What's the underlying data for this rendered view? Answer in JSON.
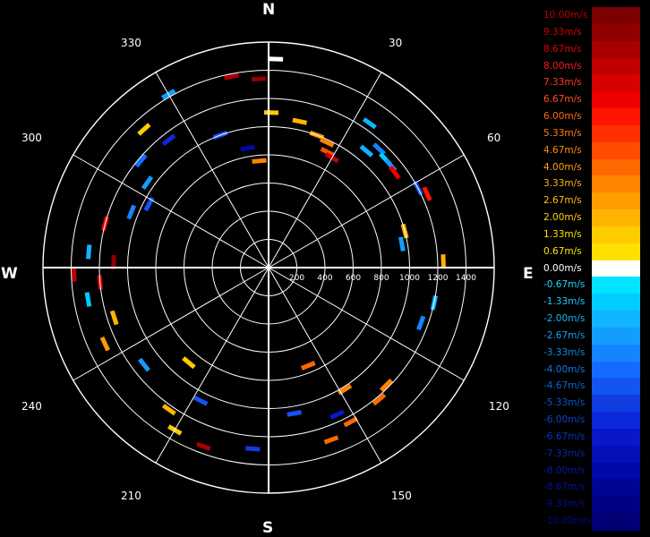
{
  "chart_data": {
    "type": "polar-radar",
    "cardinals": {
      "north": "N",
      "east": "E",
      "south": "S",
      "west": "W"
    },
    "azimuth_labels": [
      "30",
      "60",
      "120",
      "150",
      "210",
      "240",
      "300",
      "330"
    ],
    "azimuth_label_angles": [
      30,
      60,
      120,
      150,
      210,
      240,
      300,
      330
    ],
    "range_rings": [
      200,
      400,
      600,
      800,
      1000,
      1200,
      1400
    ],
    "range_tick_labels": [
      "200",
      "400",
      "600",
      "800",
      "1000",
      "1200",
      "1400"
    ],
    "max_range": 1600,
    "grid": true,
    "radial_lines_every_deg": 30,
    "legend": {
      "placement": "right",
      "labels": [
        "10.00m/s",
        "9.33m/s",
        "8.67m/s",
        "8.00m/s",
        "7.33m/s",
        "6.67m/s",
        "6.00m/s",
        "5.33m/s",
        "4.67m/s",
        "4.00m/s",
        "3.33m/s",
        "2.67m/s",
        "2.00m/s",
        "1.33m/s",
        "0.67m/s",
        "0.00m/s",
        "-0.67m/s",
        "-1.33m/s",
        "-2.00m/s",
        "-2.67m/s",
        "-3.33m/s",
        "-4.00m/s",
        "-4.67m/s",
        "-5.33m/s",
        "-6.00m/s",
        "-6.67m/s",
        "-7.33m/s",
        "-8.00m/s",
        "-8.67m/s",
        "-9.33m/s",
        "-10.00m/s"
      ],
      "label_colors": [
        "#c00000",
        "#d40000",
        "#e00000",
        "#ff1a1a",
        "#ff3a1a",
        "#ff5020",
        "#ff6a10",
        "#ff7a10",
        "#ff8c10",
        "#ffa010",
        "#ffb010",
        "#ffc010",
        "#ffd010",
        "#ffe000",
        "#ffe800",
        "#ffffff",
        "#20d8ff",
        "#1ac8ff",
        "#14b4f5",
        "#109ff0",
        "#0f8ae8",
        "#0d78e0",
        "#0b66d8",
        "#0a55d0",
        "#0a44c8",
        "#0933c0",
        "#0826b0",
        "#071aa0",
        "#06129a",
        "#050c90",
        "#040888"
      ],
      "swatch_colors": [
        "#7d0000",
        "#900000",
        "#a80000",
        "#c00000",
        "#d80000",
        "#ee0000",
        "#ff1400",
        "#ff3000",
        "#ff4c00",
        "#ff6800",
        "#ff8400",
        "#ff9c00",
        "#ffb400",
        "#ffcc00",
        "#ffe000",
        "#ffffff",
        "#00e4ff",
        "#00ccff",
        "#10b4ff",
        "#149cff",
        "#1484ff",
        "#146cff",
        "#1454f0",
        "#103ce0",
        "#0c28d8",
        "#0818c8",
        "#0410b8",
        "#0008a8",
        "#000494",
        "#000084",
        "#000074"
      ]
    },
    "velocity_colormap": {
      "positive": [
        "#ffe000",
        "#ffcc00",
        "#ffb400",
        "#ff9c00",
        "#ff8400",
        "#ff6800",
        "#ff4c00",
        "#ff3000",
        "#ff1400",
        "#ee0000",
        "#d80000",
        "#c00000",
        "#a80000",
        "#900000",
        "#7d0000"
      ],
      "negative": [
        "#00e4ff",
        "#00ccff",
        "#10b4ff",
        "#149cff",
        "#1484ff",
        "#146cff",
        "#1454f0",
        "#103ce0",
        "#0c28d8",
        "#0818c8",
        "#0410b8",
        "#0008a8",
        "#000494",
        "#000084",
        "#000074"
      ],
      "zero": "#ffffff"
    },
    "velocity_gates": [
      {
        "az": 2,
        "range": 1480,
        "v": 0.0
      },
      {
        "az": -3,
        "range": 1340,
        "v": 9.3
      },
      {
        "az": -11,
        "range": 1380,
        "v": 8.7
      },
      {
        "az": 1,
        "range": 1100,
        "v": 1.3
      },
      {
        "az": 12,
        "range": 1060,
        "v": 2.0
      },
      {
        "az": 20,
        "range": 1000,
        "v": 2.7
      },
      {
        "az": 25,
        "range": 980,
        "v": 3.3
      },
      {
        "az": 27,
        "range": 920,
        "v": 4.7
      },
      {
        "az": 30,
        "range": 900,
        "v": 8.0
      },
      {
        "az": 35,
        "range": 1250,
        "v": -2.0
      },
      {
        "az": 40,
        "range": 1080,
        "v": -2.0
      },
      {
        "az": 43,
        "range": 1150,
        "v": -3.3
      },
      {
        "az": 47,
        "range": 1130,
        "v": -1.3
      },
      {
        "az": 50,
        "range": 1130,
        "v": -2.7
      },
      {
        "az": 53,
        "range": 1120,
        "v": 6.7
      },
      {
        "az": 62,
        "range": 1200,
        "v": -4.7
      },
      {
        "az": 65,
        "range": 1240,
        "v": 6.0
      },
      {
        "az": 75,
        "range": 1000,
        "v": 2.0
      },
      {
        "az": 80,
        "range": 960,
        "v": -2.7
      },
      {
        "az": 88,
        "range": 1240,
        "v": 2.0
      },
      {
        "az": 102,
        "range": 1200,
        "v": -2.0
      },
      {
        "az": 110,
        "range": 1150,
        "v": -3.3
      },
      {
        "az": 135,
        "range": 1180,
        "v": 3.3
      },
      {
        "az": 140,
        "range": 1220,
        "v": 4.0
      },
      {
        "az": 148,
        "range": 1020,
        "v": 3.3
      },
      {
        "az": 152,
        "range": 1240,
        "v": 4.0
      },
      {
        "az": 155,
        "range": 1150,
        "v": -6.7
      },
      {
        "az": 160,
        "range": 1300,
        "v": 4.0
      },
      {
        "az": 158,
        "range": 750,
        "v": 4.0
      },
      {
        "az": 170,
        "range": 1050,
        "v": -4.7
      },
      {
        "az": 185,
        "range": 1290,
        "v": -5.3
      },
      {
        "az": 200,
        "range": 1350,
        "v": 8.7
      },
      {
        "az": 207,
        "range": 1060,
        "v": -4.7
      },
      {
        "az": 210,
        "range": 1330,
        "v": 1.3
      },
      {
        "az": 215,
        "range": 1230,
        "v": 2.0
      },
      {
        "az": 220,
        "range": 880,
        "v": 1.3
      },
      {
        "az": 232,
        "range": 1120,
        "v": -2.7
      },
      {
        "az": 245,
        "range": 1280,
        "v": 2.7
      },
      {
        "az": 252,
        "range": 1150,
        "v": 2.0
      },
      {
        "az": 260,
        "range": 1300,
        "v": -1.3
      },
      {
        "az": 265,
        "range": 1200,
        "v": 7.3
      },
      {
        "az": 268,
        "range": 1380,
        "v": 8.0
      },
      {
        "az": 272,
        "range": 1100,
        "v": 9.3
      },
      {
        "az": 275,
        "range": 1280,
        "v": -2.0
      },
      {
        "az": 285,
        "range": 1200,
        "v": 6.7
      },
      {
        "az": 292,
        "range": 1050,
        "v": -3.3
      },
      {
        "az": 298,
        "range": 960,
        "v": -4.7
      },
      {
        "az": 305,
        "range": 1050,
        "v": -2.7
      },
      {
        "az": 310,
        "range": 1180,
        "v": -4.0
      },
      {
        "az": 318,
        "range": 1320,
        "v": 1.3
      },
      {
        "az": 322,
        "range": 1150,
        "v": -6.0
      },
      {
        "az": 330,
        "range": 1420,
        "v": -2.7
      },
      {
        "az": 340,
        "range": 1000,
        "v": -4.7
      },
      {
        "az": 350,
        "range": 860,
        "v": -8.0
      },
      {
        "az": 355,
        "range": 760,
        "v": 3.3
      }
    ]
  }
}
